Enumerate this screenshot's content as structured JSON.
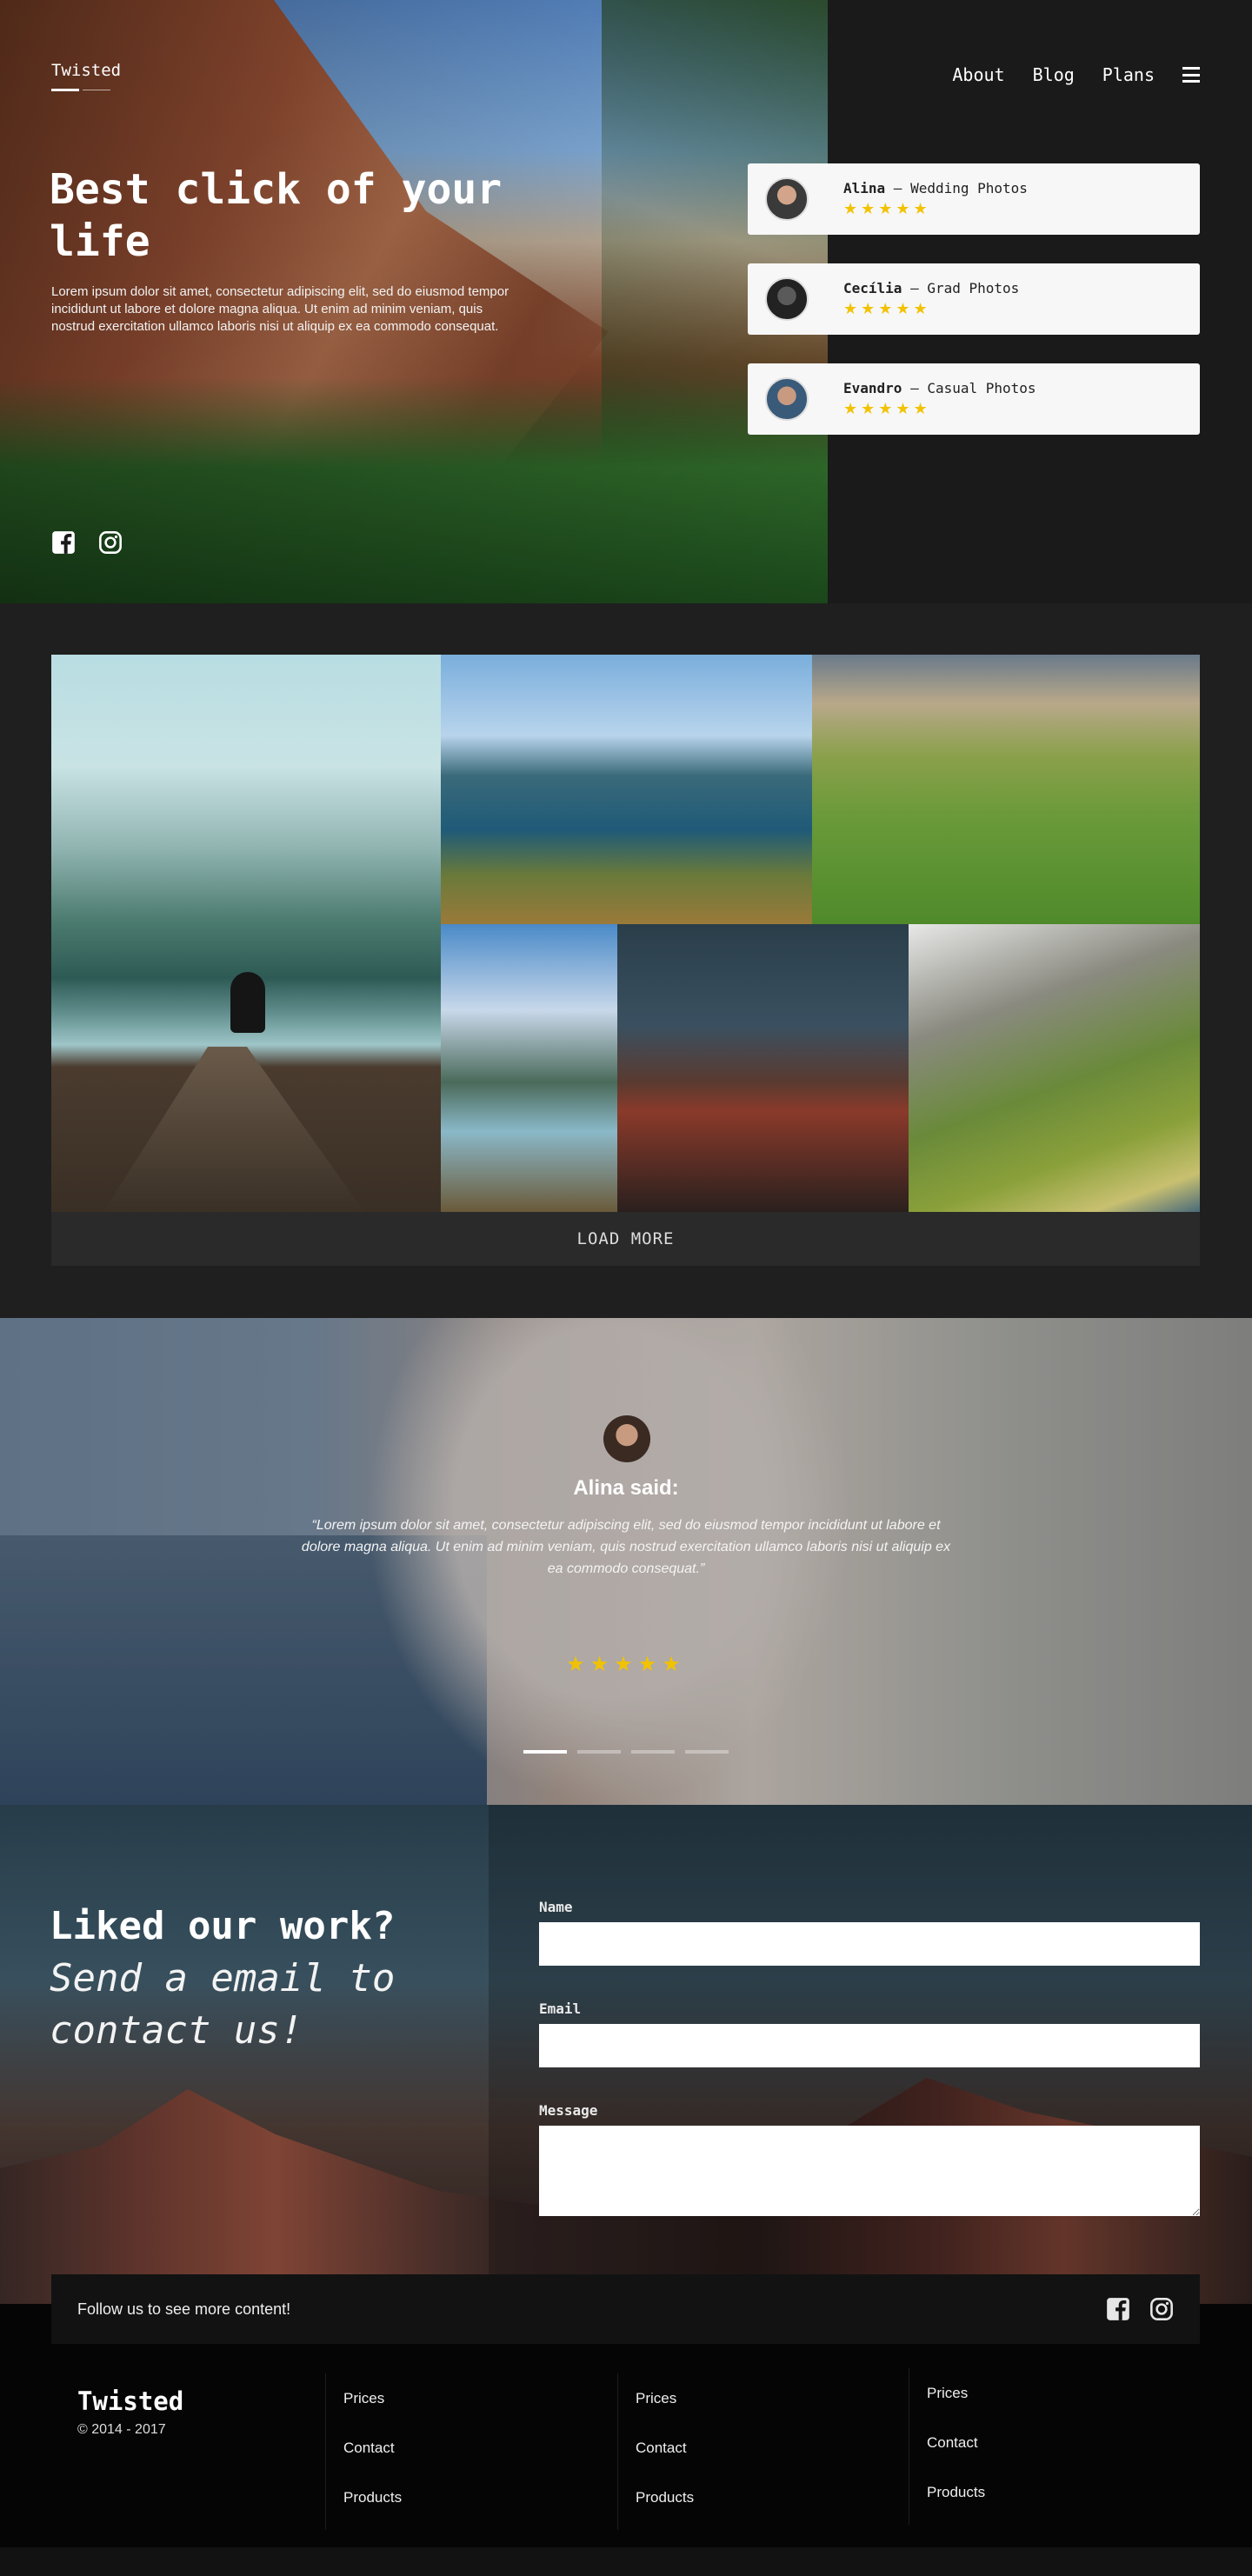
{
  "header": {
    "brand": "Twisted",
    "nav": [
      "About",
      "Blog",
      "Plans"
    ],
    "title": "Best click of your life",
    "text": "Lorem ipsum dolor sit amet, consectetur adipiscing elit, sed do eiusmod tempor incididunt ut labore et dolore magna aliqua. Ut enim ad minim veniam, quis nostrud exercitation ullamco laboris nisi ut aliquip ex ea commodo consequat.",
    "social_icons": [
      "facebook-icon",
      "instagram-icon"
    ]
  },
  "reviews": [
    {
      "name": "Alina",
      "category": " — Wedding Photos",
      "stars": "★★★★★",
      "rating": 5
    },
    {
      "name": "Cecília",
      "category": " — Grad Photos",
      "stars": "★★★★★",
      "rating": 5
    },
    {
      "name": "Evandro",
      "category": " — Casual Photos",
      "stars": "★★★★★",
      "rating": 5
    }
  ],
  "gallery": {
    "load_more": "LOAD MORE"
  },
  "testimonial": {
    "said": "Alina said:",
    "quote": "“Lorem ipsum dolor sit amet, consectetur adipiscing elit, sed do eiusmod tempor incididunt ut labore et dolore magna aliqua. Ut enim ad minim veniam, quis nostrud exercitation ullamco laboris nisi ut aliquip ex ea commodo consequat.”",
    "stars": "★★★★★",
    "rating": 5,
    "slides": 4,
    "active_slide": 1
  },
  "contact": {
    "title": "Liked our work?",
    "subtitle": "Send a email to contact us!",
    "name_label": "Name",
    "email_label": "Email",
    "message_label": "Message"
  },
  "footer": {
    "follow": "Follow us to see more content!",
    "brand": "Twisted",
    "copyright": "© 2014 - 2017",
    "columns": [
      [
        "Prices",
        "Contact",
        "Products"
      ],
      [
        "Prices",
        "Contact",
        "Products"
      ],
      [
        "Prices",
        "Contact",
        "Products"
      ]
    ]
  },
  "colors": {
    "star": "#f2c200",
    "dark_bg": "#1a1a1a",
    "footer_bg": "#050505"
  }
}
